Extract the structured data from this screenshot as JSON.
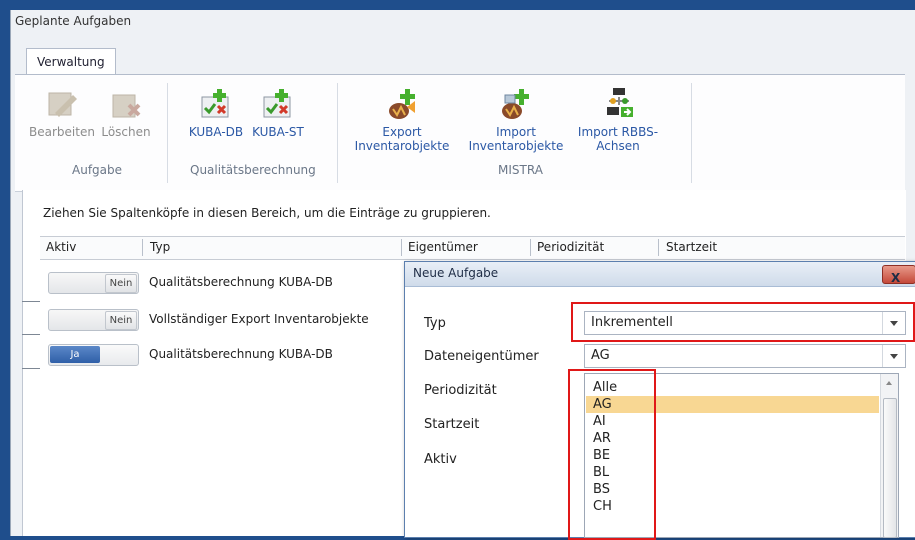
{
  "window": {
    "title": "Geplante Aufgaben"
  },
  "tabs": [
    {
      "label": "Verwaltung"
    }
  ],
  "ribbon": {
    "groups": [
      {
        "label": "Aufgabe",
        "buttons": [
          {
            "label": "Bearbeiten",
            "icon": "edit-icon",
            "enabled": false
          },
          {
            "label": "Löschen",
            "icon": "delete-icon",
            "enabled": false
          }
        ]
      },
      {
        "label": "Qualitätsberechnung",
        "buttons": [
          {
            "label": "KUBA-DB",
            "icon": "quality-calc-icon"
          },
          {
            "label": "KUBA-ST",
            "icon": "quality-calc-icon"
          }
        ]
      },
      {
        "label": "MISTRA",
        "buttons": [
          {
            "label_line1": "Export",
            "label_line2": "Inventarobjekte",
            "icon": "export-icon"
          },
          {
            "label_line1": "Import",
            "label_line2": "Inventarobjekte",
            "icon": "import-icon"
          },
          {
            "label_line1": "Import RBBS-",
            "label_line2": "Achsen",
            "icon": "import-axes-icon"
          }
        ]
      }
    ]
  },
  "grid": {
    "group_hint": "Ziehen Sie Spaltenköpfe in diesen Bereich, um die Einträge zu gruppieren.",
    "columns": [
      "Aktiv",
      "Typ",
      "Eigentümer",
      "Periodizität",
      "Startzeit"
    ],
    "rows": [
      {
        "aktiv": "Nein",
        "typ": "Qualitätsberechnung KUBA-DB"
      },
      {
        "aktiv": "Nein",
        "typ": "Vollständiger Export Inventarobjekte"
      },
      {
        "aktiv": "Ja",
        "typ": "Qualitätsberechnung KUBA-DB"
      }
    ]
  },
  "dialog": {
    "title": "Neue Aufgabe",
    "close_label": "X",
    "fields": {
      "typ": {
        "label": "Typ",
        "value": "Inkrementell"
      },
      "dateneigentuemer": {
        "label": "Dateneigentümer",
        "value": "AG"
      },
      "periodizitaet": {
        "label": "Periodizität"
      },
      "startzeit": {
        "label": "Startzeit"
      },
      "aktiv": {
        "label": "Aktiv"
      }
    },
    "dropdown_options": [
      "Alle",
      "AG",
      "AI",
      "AR",
      "BE",
      "BL",
      "BS",
      "CH"
    ],
    "selected_option": "AG"
  },
  "colors": {
    "highlight": "#f8d793",
    "toggle_on": "#2f5fa8",
    "annotation_red": "#e01818",
    "accent_blue": "#2b58a5"
  }
}
